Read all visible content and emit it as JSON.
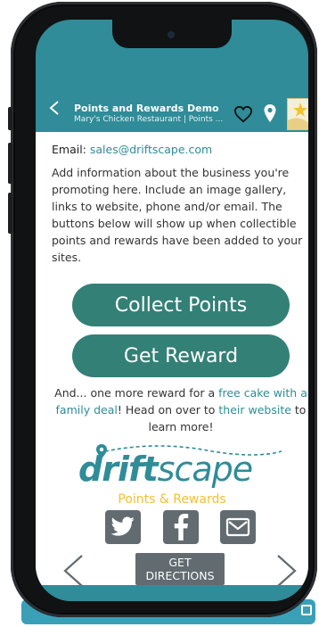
{
  "header": {
    "title": "Points and Rewards Demo",
    "subtitle": "Mary's Chicken Restaurant | Points ..."
  },
  "content": {
    "email_label": "Email: ",
    "email": "sales@driftscape.com",
    "description": "Add information about the business you're promoting here. Include an image gallery, links to website, phone and/or email. The buttons below will show up when collectible points and rewards have been added to your sites.",
    "collect_button": "Collect Points",
    "reward_button": "Get Reward",
    "more_text_1": "And... one more reward for a ",
    "more_link_1": "free cake with a family deal",
    "more_text_2": "! Head on over to ",
    "more_link_2": "their website",
    "more_text_3": " to learn more!"
  },
  "logo": {
    "word_drift": "drift",
    "word_scape": "scape",
    "tagline": "Points & Rewards"
  },
  "social": [
    "twitter-icon",
    "facebook-icon",
    "mail-icon"
  ],
  "footer": {
    "directions_line1": "GET",
    "directions_line2": "DIRECTIONS"
  },
  "colors": {
    "brand_teal": "#2f8c98",
    "button_green": "#338076",
    "gold": "#f2c12e",
    "gray_button": "#626b70"
  }
}
